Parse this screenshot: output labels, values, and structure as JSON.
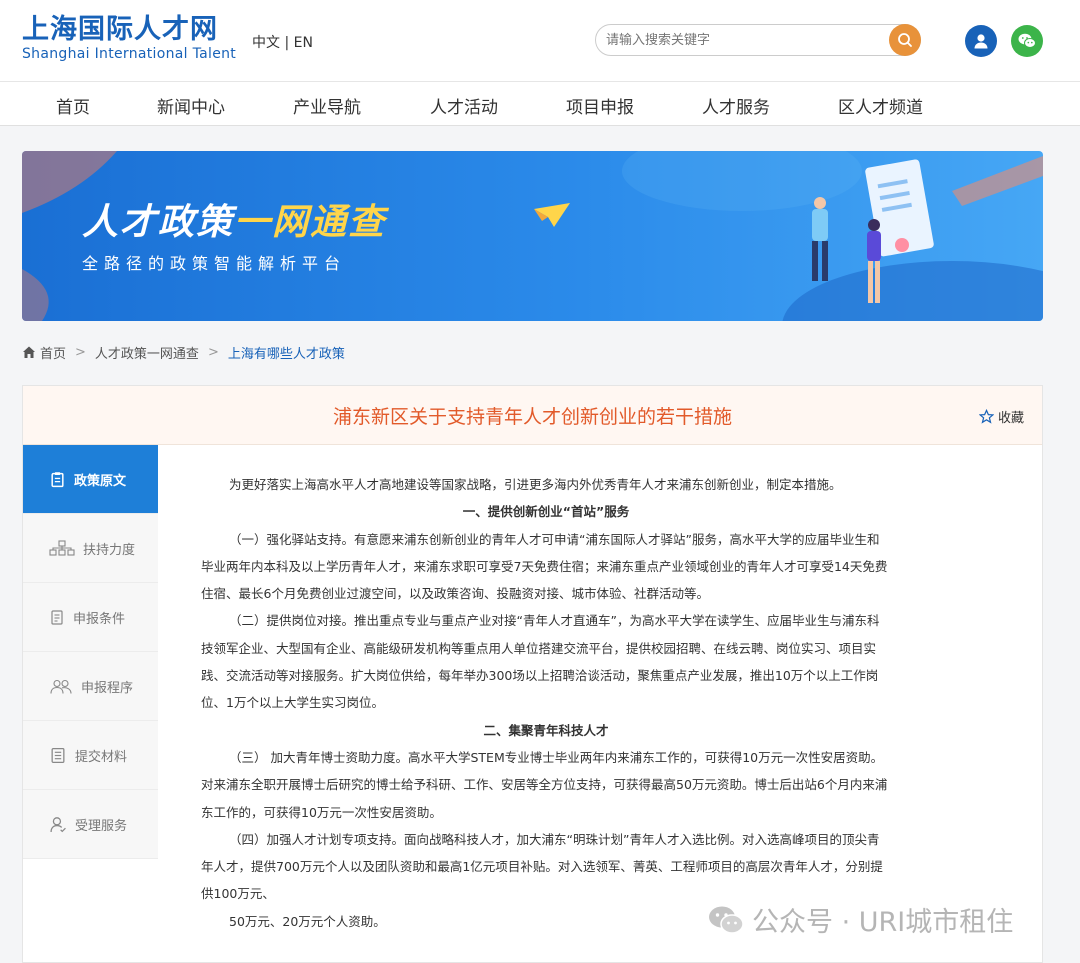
{
  "header": {
    "logo_cn": "上海国际人才网",
    "logo_en": "Shanghai International Talent",
    "lang": "中文 | EN",
    "search_placeholder": "请输入搜索关键字"
  },
  "nav": [
    "首页",
    "新闻中心",
    "产业导航",
    "人才活动",
    "项目申报",
    "人才服务",
    "区人才频道"
  ],
  "banner": {
    "title_part1": "人才政策",
    "title_part2": "一网通查",
    "subtitle": "全路径的政策智能解析平台"
  },
  "breadcrumb": [
    "首页",
    "人才政策一网通查",
    "上海有哪些人才政策"
  ],
  "doc": {
    "title": "浦东新区关于支持青年人才创新创业的若干措施",
    "favorite": "收藏"
  },
  "sidebar": [
    "政策原文",
    "扶持力度",
    "申报条件",
    "申报程序",
    "提交材料",
    "受理服务"
  ],
  "body": {
    "intro": "为更好落实上海高水平人才高地建设等国家战略，引进更多海内外优秀青年人才来浦东创新创业，制定本措施。",
    "h1": "一、提供创新创业“首站”服务",
    "p1": "（一）强化驿站支持。有意愿来浦东创新创业的青年人才可申请“浦东国际人才驿站”服务，高水平大学的应届毕业生和毕业两年内本科及以上学历青年人才，来浦东求职可享受7天免费住宿；来浦东重点产业领域创业的青年人才可享受14天免费住宿、最长6个月免费创业过渡空间，以及政策咨询、投融资对接、城市体验、社群活动等。",
    "p2": "（二）提供岗位对接。推出重点专业与重点产业对接“青年人才直通车”，为高水平大学在读学生、应届毕业生与浦东科技领军企业、大型国有企业、高能级研发机构等重点用人单位搭建交流平台，提供校园招聘、在线云聘、岗位实习、项目实践、交流活动等对接服务。扩大岗位供给，每年举办300场以上招聘洽谈活动，聚焦重点产业发展，推出10万个以上工作岗位、1万个以上大学生实习岗位。",
    "h2": "二、集聚青年科技人才",
    "p3": "（三） 加大青年博士资助力度。高水平大学STEM专业博士毕业两年内来浦东工作的，可获得10万元一次性安居资助。对来浦东全职开展博士后研究的博士给予科研、工作、安居等全方位支持，可获得最高50万元资助。博士后出站6个月内来浦东工作的，可获得10万元一次性安居资助。",
    "p4": "（四）加强人才计划专项支持。面向战略科技人才，加大浦东“明珠计划”青年人才入选比例。对入选高峰项目的顶尖青年人才，提供700万元个人以及团队资助和最高1亿元项目补贴。对入选领军、菁英、工程师项目的高层次青年人才，分别提供100万元、",
    "p5": "50万元、20万元个人资助。"
  },
  "watermark": "公众号 · URI城市租住"
}
